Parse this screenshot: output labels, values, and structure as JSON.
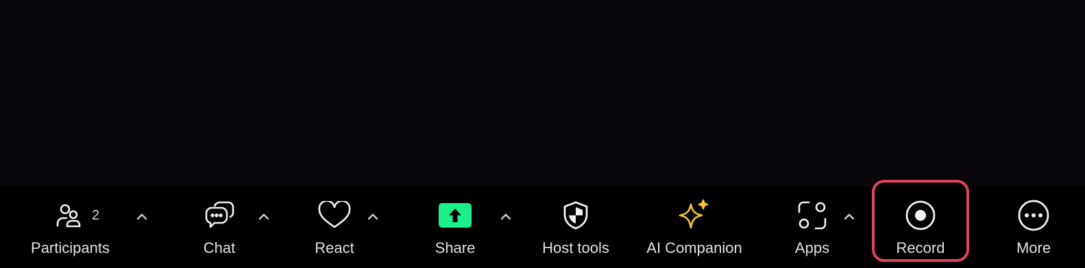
{
  "toolbar": {
    "participants": {
      "label": "Participants",
      "count": "2",
      "icon": "participants-icon"
    },
    "chat": {
      "label": "Chat",
      "icon": "chat-bubbles-icon"
    },
    "react": {
      "label": "React",
      "icon": "heart-icon"
    },
    "share": {
      "label": "Share",
      "icon": "share-screen-icon",
      "accent": "#1cf08c"
    },
    "host_tools": {
      "label": "Host tools",
      "icon": "shield-icon"
    },
    "ai_companion": {
      "label": "AI Companion",
      "icon": "sparkle-icon",
      "accent": "#f6c637"
    },
    "apps": {
      "label": "Apps",
      "icon": "apps-icon"
    },
    "record": {
      "label": "Record",
      "icon": "record-icon",
      "highlight": "#e0435e"
    },
    "more": {
      "label": "More",
      "icon": "more-dots-icon"
    }
  }
}
